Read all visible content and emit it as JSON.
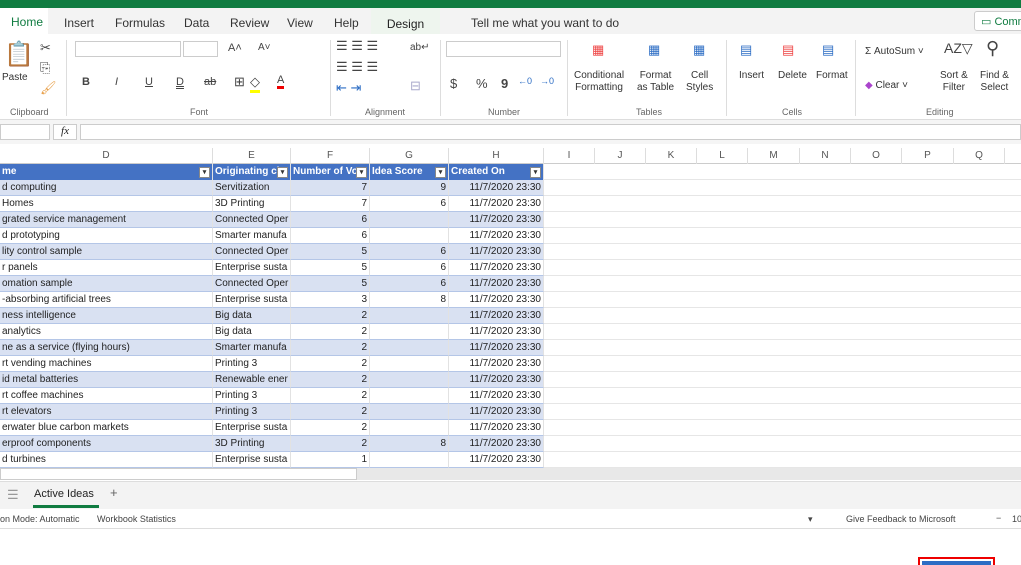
{
  "tabs": [
    "Home",
    "Insert",
    "Formulas",
    "Data",
    "Review",
    "View",
    "Help"
  ],
  "design_tab": "Design",
  "tell_me": "Tell me what you want to do",
  "comments_label": "Comm",
  "ribbon": {
    "paste": "Paste",
    "clipboard": "Clipboard",
    "font": "Font",
    "alignment": "Alignment",
    "number": "Number",
    "cond_fmt_1": "Conditional",
    "cond_fmt_2": "Formatting",
    "fmt_table_1": "Format",
    "fmt_table_2": "as Table",
    "cell_styles_1": "Cell",
    "cell_styles_2": "Styles",
    "tables": "Tables",
    "insert": "Insert",
    "delete": "Delete",
    "format": "Format",
    "cells": "Cells",
    "autosum": "AutoSum",
    "clear": "Clear",
    "sort_1": "Sort &",
    "sort_2": "Filter",
    "find_1": "Find &",
    "find_2": "Select",
    "editing": "Editing",
    "bold": "B",
    "italic": "I",
    "underline": "U",
    "double_underline": "D",
    "strike": "ab",
    "currency": "$",
    "percent": "%",
    "comma": "9"
  },
  "formula_bar": {
    "fx": "fx",
    "value": ""
  },
  "columns": [
    "D",
    "E",
    "F",
    "G",
    "H",
    "I",
    "J",
    "K",
    "L",
    "M",
    "N",
    "O",
    "P",
    "Q"
  ],
  "table_headers": [
    "me",
    "Originating cl",
    "Number of Vo",
    "Idea Score",
    "Created On"
  ],
  "rows": [
    [
      "d computing",
      "Servitization",
      "7",
      "9",
      "11/7/2020 23:30"
    ],
    [
      " Homes",
      "3D Printing",
      "7",
      "6",
      "11/7/2020 23:30"
    ],
    [
      "grated service management",
      "Connected Oper",
      "6",
      "",
      "11/7/2020 23:30"
    ],
    [
      "d prototyping",
      "Smarter manufa",
      "6",
      "",
      "11/7/2020 23:30"
    ],
    [
      "lity control sample",
      "Connected Oper",
      "5",
      "6",
      "11/7/2020 23:30"
    ],
    [
      "r panels",
      "Enterprise susta",
      "5",
      "6",
      "11/7/2020 23:30"
    ],
    [
      "omation sample",
      "Connected Oper",
      "5",
      "6",
      "11/7/2020 23:30"
    ],
    [
      "-absorbing artificial trees",
      "Enterprise susta",
      "3",
      "8",
      "11/7/2020 23:30"
    ],
    [
      "ness intelligence",
      "Big data",
      "2",
      "",
      "11/7/2020 23:30"
    ],
    [
      " analytics",
      "Big data",
      "2",
      "",
      "11/7/2020 23:30"
    ],
    [
      "ne as a service (flying hours)",
      "Smarter manufa",
      "2",
      "",
      "11/7/2020 23:30"
    ],
    [
      "rt vending machines",
      "Printing 3",
      "2",
      "",
      "11/7/2020 23:30"
    ],
    [
      "id metal batteries",
      "Renewable ener",
      "2",
      "",
      "11/7/2020 23:30"
    ],
    [
      "rt coffee machines",
      "Printing 3",
      "2",
      "",
      "11/7/2020 23:30"
    ],
    [
      "rt elevators",
      "Printing 3",
      "2",
      "",
      "11/7/2020 23:30"
    ],
    [
      "erwater blue carbon markets",
      "Enterprise susta",
      "2",
      "",
      "11/7/2020 23:30"
    ],
    [
      "erproof components",
      "3D Printing",
      "2",
      "8",
      "11/7/2020 23:30"
    ],
    [
      "d turbines",
      "Enterprise susta",
      "1",
      "",
      "11/7/2020 23:30"
    ]
  ],
  "sheet_tab": "Active Ideas",
  "add_sheet": "+",
  "status": {
    "calc_mode": "on Mode: Automatic",
    "workbook_stats": "Workbook Statistics",
    "feedback": "Give Feedback to Microsoft",
    "zoom": "10"
  },
  "colors": {
    "brand": "#107c41",
    "table_header": "#4472c4",
    "band": "#d9e1f2"
  }
}
